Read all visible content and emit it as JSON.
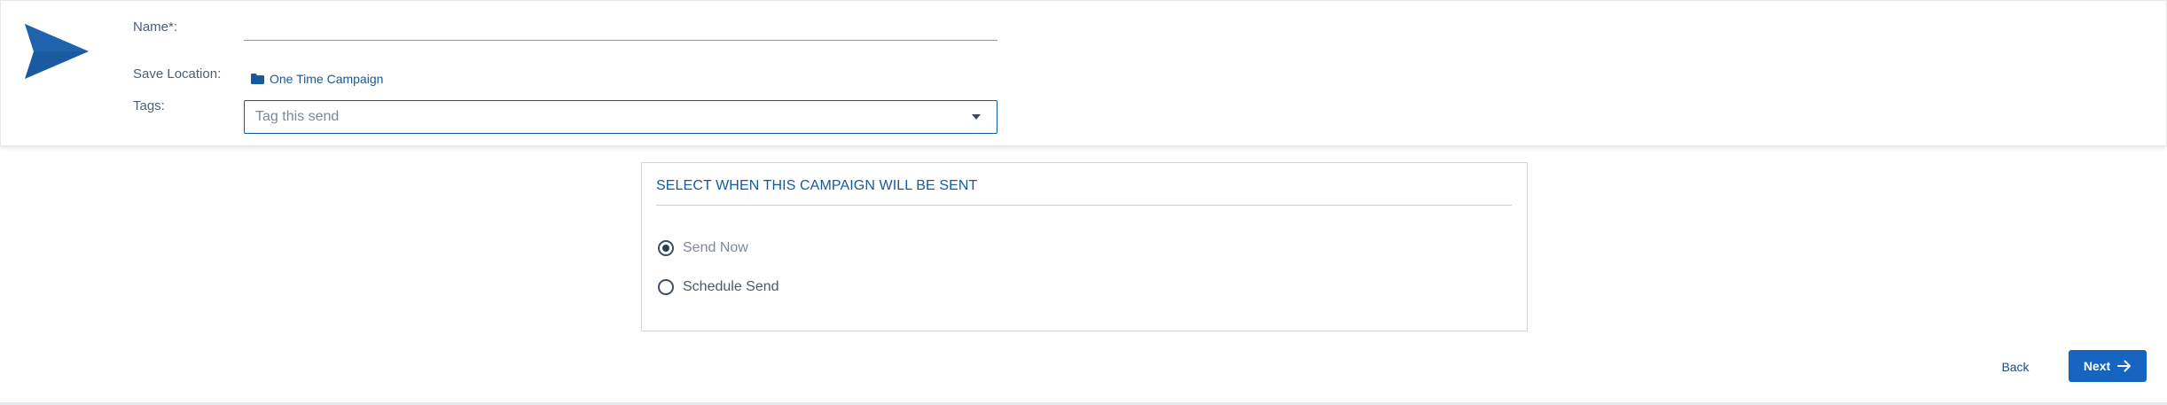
{
  "form": {
    "name_label": "Name*:",
    "name_value": "",
    "save_location_label": "Save Location:",
    "save_location_value": "One Time Campaign",
    "tags_label": "Tags:",
    "tags_placeholder": "Tag this send"
  },
  "schedule": {
    "title": "SELECT WHEN THIS CAMPAIGN WILL BE SENT",
    "options": [
      {
        "label": "Send Now",
        "selected": true
      },
      {
        "label": "Schedule Send",
        "selected": false
      }
    ]
  },
  "footer": {
    "back_label": "Back",
    "next_label": "Next"
  },
  "icons": {
    "logo": "paper-plane-icon",
    "location": "folder-icon",
    "tags_dropdown": "caret-down-icon",
    "next": "arrow-right-icon"
  },
  "colors": {
    "accent": "#145a9e",
    "primary_button": "#1565c0",
    "text": "#4a5b6e"
  }
}
